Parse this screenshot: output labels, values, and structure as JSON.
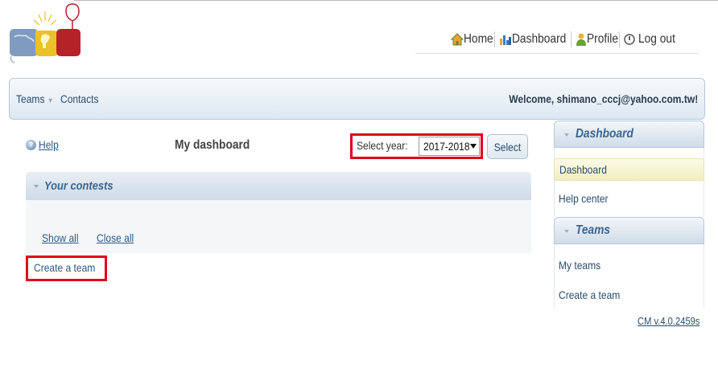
{
  "topnav": {
    "home": "Home",
    "dashboard": "Dashboard",
    "profile": "Profile",
    "logout": "Log out"
  },
  "menubar": {
    "teams": "Teams",
    "contacts": "Contacts",
    "welcome": "Welcome, shimano_cccj@yahoo.com.tw!"
  },
  "main": {
    "help": "Help",
    "title": "My dashboard",
    "select_year_label": "Select year:",
    "year_value": "2017-2018",
    "select_button": "Select",
    "contests_title": "Your contests",
    "show_all": "Show all",
    "close_all": "Close all",
    "create_team": "Create a team"
  },
  "sidebar": {
    "dashboard_header": "Dashboard",
    "dashboard_items": [
      "Dashboard",
      "Help center"
    ],
    "teams_header": "Teams",
    "teams_items": [
      "My teams",
      "Create a team"
    ]
  },
  "version": "CM v.4.0.2459s",
  "colors": {
    "highlight_red": "#e0001a",
    "link_blue": "#2c5a85",
    "header_blue": "#3b6590"
  }
}
